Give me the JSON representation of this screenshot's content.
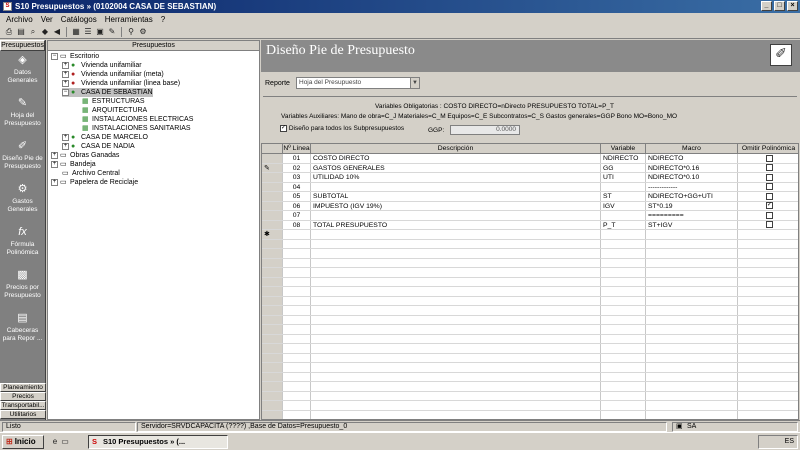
{
  "window": {
    "title": "S10 Presupuestos » (0102004 CASA DE SEBASTIAN)"
  },
  "menu": [
    "Archivo",
    "Ver",
    "Catálogos",
    "Herramientas",
    "?"
  ],
  "left_panel": {
    "header": "Presupuestos",
    "items": [
      {
        "label": "Datos Generales",
        "icon": "data-icon"
      },
      {
        "label": "Hoja del Presupuesto",
        "icon": "sheet-icon"
      },
      {
        "label": "Diseño Pie de Presupuesto",
        "icon": "design-icon"
      },
      {
        "label": "Gastos Generales",
        "icon": "gears-icon"
      },
      {
        "label": "Fórmula Polinómica",
        "icon": "fx-icon"
      },
      {
        "label": "Precios por Presupuesto",
        "icon": "prices-icon"
      },
      {
        "label": "Cabeceras para Repor ...",
        "icon": "report-icon"
      }
    ],
    "bottom": [
      "Planeamiento",
      "Precios",
      "Transportabil...",
      "Utilitarios"
    ]
  },
  "tree": {
    "header": "Presupuestos",
    "nodes": [
      {
        "label": "Escritorio"
      },
      {
        "label": "Vivienda unifamiliar"
      },
      {
        "label": "Vivienda unifamiliar (meta)"
      },
      {
        "label": "Vivienda unifamiliar (linea base)"
      },
      {
        "label": "CASA DE SEBASTIAN"
      },
      {
        "label": "ESTRUCTURAS"
      },
      {
        "label": "ARQUITECTURA"
      },
      {
        "label": "INSTALACIONES ELECTRICAS"
      },
      {
        "label": "INSTALACIONES SANITARIAS"
      },
      {
        "label": "CASA DE MARCELO"
      },
      {
        "label": "CASA DE NADIA"
      },
      {
        "label": "Obras Ganadas"
      },
      {
        "label": "Bandeja"
      },
      {
        "label": "Archivo Central"
      },
      {
        "label": "Papelera de Reciclaje"
      }
    ]
  },
  "content": {
    "title": "Diseño Pie de Presupuesto",
    "reporte_label": "Reporte",
    "reporte_value": "Hoja del Presupuesto",
    "vars_obligatorias": "Variables Obligatorias : COSTO DIRECTO=nDirecto        PRESUPUESTO TOTAL=P_T",
    "vars_auxiliares": "Variables Auxiliares: Mano de obra=C_J  Materiales=C_M  Equipos=C_E  Subcontratos=C_S  Gastos generales=GGP  Bono MO=Bono_MO",
    "checkbox_label": "Diseño para todos los Subpresupuestos",
    "ggp_label": "GGP:",
    "ggp_value": "0.0000"
  },
  "grid": {
    "columns": [
      "Nº Línea",
      "Descripción",
      "Variable",
      "Macro",
      "Omitir Polinómica"
    ],
    "rows": [
      {
        "n": "01",
        "desc": "COSTO DIRECTO",
        "var": "NDIRECTO",
        "macro": "NDIRECTO",
        "omit": false
      },
      {
        "n": "02",
        "desc": "GASTOS GENERALES",
        "var": "GG",
        "macro": "NDIRECTO*0.16",
        "omit": false
      },
      {
        "n": "03",
        "desc": "UTILIDAD        10%",
        "var": "UTI",
        "macro": "NDIRECTO*0.10",
        "omit": false
      },
      {
        "n": "04",
        "desc": "",
        "var": "",
        "macro": "-------------",
        "omit": false
      },
      {
        "n": "05",
        "desc": "SUBTOTAL",
        "var": "ST",
        "macro": "NDIRECTO+GG+UTI",
        "omit": false
      },
      {
        "n": "06",
        "desc": "IMPUESTO (IGV 19%)",
        "var": "IGV",
        "macro": "ST*0.19",
        "omit": true
      },
      {
        "n": "07",
        "desc": "",
        "var": "",
        "macro": "=========",
        "omit": false
      },
      {
        "n": "08",
        "desc": "TOTAL PRESUPUESTO",
        "var": "P_T",
        "macro": "ST+IGV",
        "omit": false
      }
    ]
  },
  "status": {
    "left": "Listo",
    "server": "Servidor=SRVDCAPACITA (????) ,Base de Datos=Presupuesto_0",
    "user": "SA"
  },
  "taskbar": {
    "start": "Inicio",
    "app": "S10 Presupuestos » (...",
    "tray": "ES"
  }
}
